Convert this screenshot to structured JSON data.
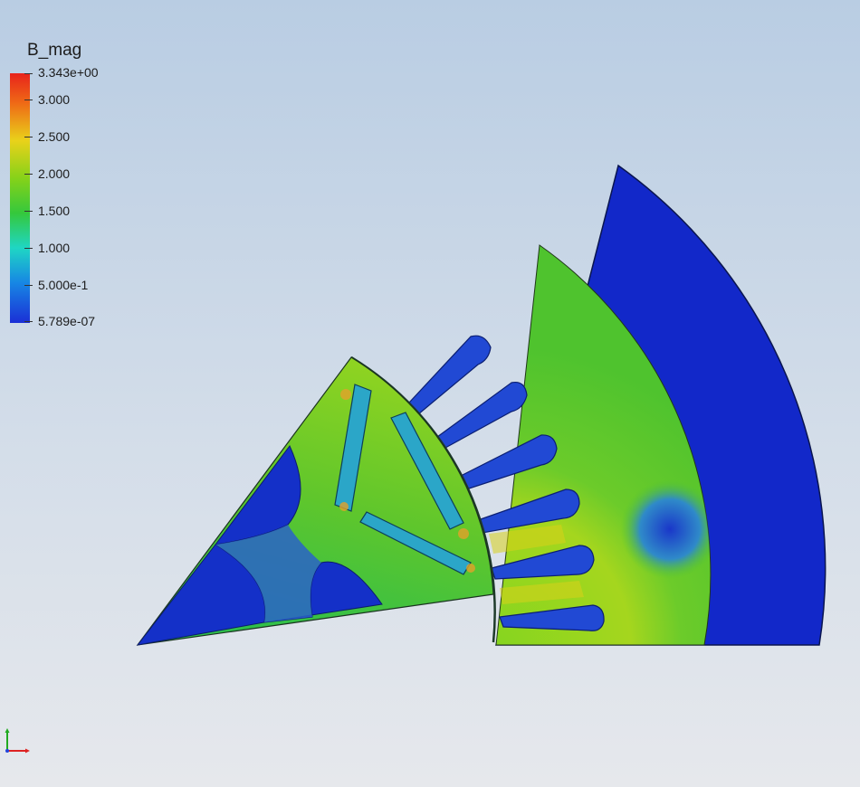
{
  "legend": {
    "title": "B_mag",
    "labels": [
      "3.343e+00",
      "3.000",
      "2.500",
      "2.000",
      "1.500",
      "1.000",
      "5.000e-1",
      "5.789e-07"
    ]
  },
  "colors": {
    "air": "#1228c9",
    "iron": "#5cc22a",
    "slot": "#1f4fd1",
    "magnet": "#2ba6c8",
    "saturated": "#d7d918"
  },
  "icons": {
    "axes_triad": "axes-triad-icon"
  }
}
